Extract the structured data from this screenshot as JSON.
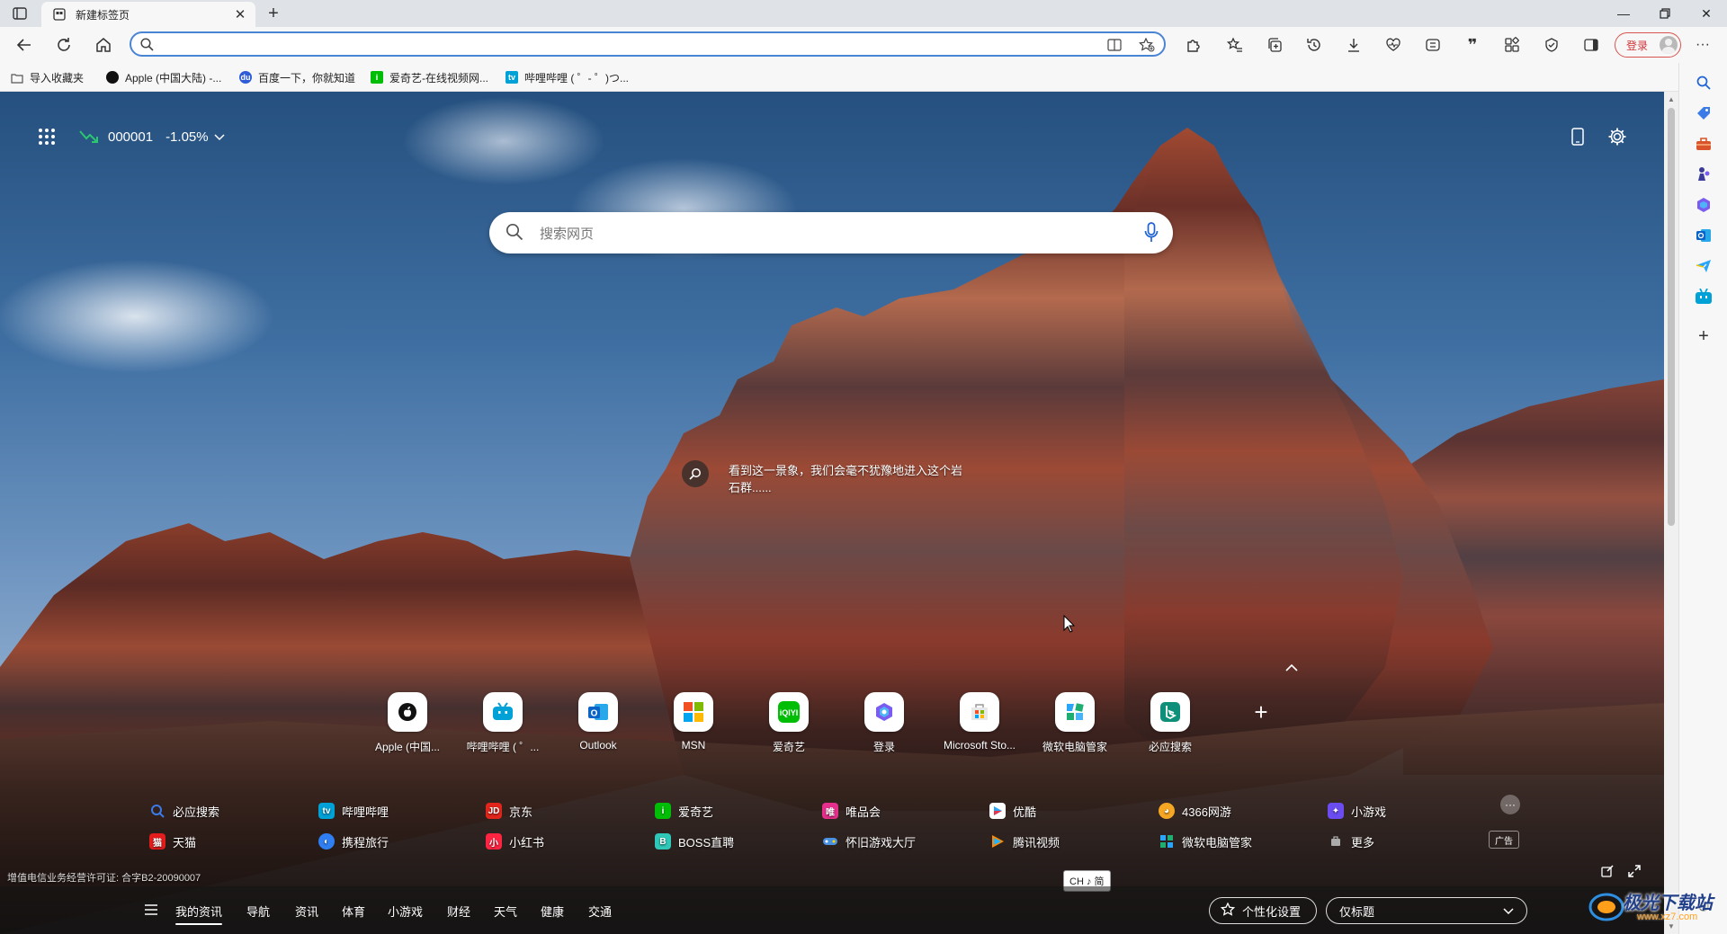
{
  "browser": {
    "tab": {
      "title": "新建标签页"
    },
    "address": {
      "value": "",
      "placeholder": ""
    },
    "login_label": "登录"
  },
  "favorites": [
    {
      "label": "导入收藏夹",
      "icon": "import-favorites-icon",
      "color": "#555555"
    },
    {
      "label": "Apple (中国大陆) -...",
      "icon": "apple-icon",
      "color": "#111111"
    },
    {
      "label": "百度一下，你就知道",
      "icon": "baidu-icon",
      "color": "#2e5cd8"
    },
    {
      "label": "爱奇艺-在线视频网...",
      "icon": "iqiyi-icon",
      "color": "#00be06"
    },
    {
      "label": "哔哩哔哩 ( ゜- ゜)つ...",
      "icon": "bilibili-icon",
      "color": "#00a1d6"
    }
  ],
  "ntp": {
    "stock": {
      "code": "000001",
      "change": "-1.05%",
      "trend_color": "#29c76f"
    },
    "search_placeholder": "搜索网页",
    "image_caption": "看到这一景象，我们会毫不犹豫地进入这个岩石群......",
    "quick_links": [
      {
        "label": "Apple (中国...",
        "icon": "apple-icon",
        "color": "#111111"
      },
      {
        "label": "哔哩哔哩 ( ゜...",
        "icon": "bilibili-icon",
        "color": "#00a1d6"
      },
      {
        "label": "Outlook",
        "icon": "outlook-icon",
        "color": "#0a64c8"
      },
      {
        "label": "MSN",
        "icon": "msn-icon",
        "color": "#f25022"
      },
      {
        "label": "爱奇艺",
        "icon": "iqiyi-icon",
        "color": "#00be06"
      },
      {
        "label": "登录",
        "icon": "copilot-icon",
        "color": "#7a5cf0"
      },
      {
        "label": "Microsoft Sto...",
        "icon": "store-icon",
        "color": "#f0b000"
      },
      {
        "label": "微软电脑管家",
        "icon": "pc-manager-icon",
        "color": "#1fae72"
      },
      {
        "label": "必应搜索",
        "icon": "bing-icon",
        "color": "#0d8f7a"
      }
    ],
    "site_links_row1": [
      {
        "label": "必应搜索",
        "icon": "search-icon",
        "color": "#3b7be8",
        "glyph": ""
      },
      {
        "label": "哔哩哔哩",
        "icon": "bilibili-icon",
        "color": "#00a1d6",
        "glyph": ""
      },
      {
        "label": "京东",
        "icon": "jd-icon",
        "color": "#e1251b",
        "glyph": "JD"
      },
      {
        "label": "爱奇艺",
        "icon": "iqiyi-icon",
        "color": "#00be06",
        "glyph": "i"
      },
      {
        "label": "唯品会",
        "icon": "vip-icon",
        "color": "#e62e8b",
        "glyph": "唯"
      },
      {
        "label": "优酷",
        "icon": "youku-icon",
        "color": "#2aa5f8",
        "glyph": ""
      },
      {
        "label": "4366网游",
        "icon": "4366-icon",
        "color": "#f5a623",
        "glyph": ""
      },
      {
        "label": "小游戏",
        "icon": "mini-game-icon",
        "color": "#6a4cf0",
        "glyph": ""
      }
    ],
    "site_links_row2": [
      {
        "label": "天猫",
        "icon": "tmall-icon",
        "color": "#e31c1c",
        "glyph": "猫"
      },
      {
        "label": "携程旅行",
        "icon": "ctrip-icon",
        "color": "#2f7ff2",
        "glyph": ""
      },
      {
        "label": "小红书",
        "icon": "xiaohongshu-icon",
        "color": "#ff2442",
        "glyph": "小"
      },
      {
        "label": "BOSS直聘",
        "icon": "boss-icon",
        "color": "#2fc7b8",
        "glyph": "B"
      },
      {
        "label": "怀旧游戏大厅",
        "icon": "retro-game-icon",
        "color": "#4a90e2",
        "glyph": ""
      },
      {
        "label": "腾讯视频",
        "icon": "tencent-video-icon",
        "color": "#ff8a00",
        "glyph": ""
      },
      {
        "label": "微软电脑管家",
        "icon": "pc-manager-icon",
        "color": "#1fae72",
        "glyph": ""
      },
      {
        "label": "更多",
        "icon": "more-icon",
        "color": "#888888",
        "glyph": ""
      }
    ],
    "ad_label": "广告",
    "license_text": "增值电信业务经营许可证: 合字B2-20090007",
    "ime_text": "CH ♪ 简",
    "news_tabs": [
      "我的资讯",
      "导航",
      "资讯",
      "体育",
      "小游戏",
      "财经",
      "天气",
      "健康",
      "交通"
    ],
    "personalize_label": "个性化设置",
    "layout_option": "仅标题"
  },
  "watermark": {
    "title": "极光下载站",
    "sub": "www.xz7.com"
  }
}
